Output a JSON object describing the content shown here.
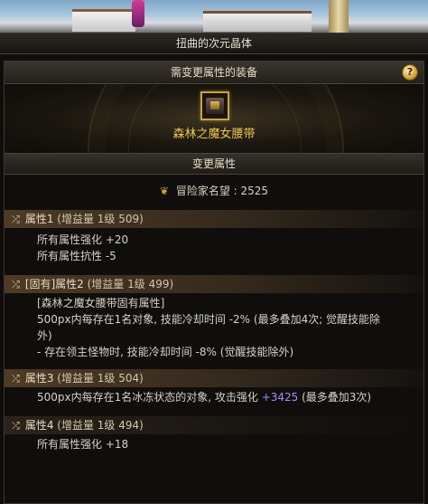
{
  "window": {
    "title": "扭曲的次元晶体"
  },
  "equip_section": {
    "header": "需变更属性的装备",
    "help_label": "?",
    "item_icon": "belt-icon",
    "item_name": "森林之魔女腰带"
  },
  "change_section": {
    "header": "变更属性",
    "fame_icon": "laurel-icon",
    "fame_label": "冒险家名望 : 2525"
  },
  "attributes": [
    {
      "icon": "shuffle-icon",
      "title": "属性1",
      "meta": " (增益量 1级 509)",
      "lines": [
        "所有属性强化 +20",
        "所有属性抗性 -5"
      ]
    },
    {
      "icon": "shuffle-icon",
      "title": "[固有]属性2",
      "meta": " (增益量 1级 499)",
      "lines": [
        "[森林之魔女腰带固有属性]",
        "500px内每存在1名对象, 技能冷却时间 -2% (最多叠加4次; 觉醒技能除外)",
        "- 存在领主怪物时, 技能冷却时间 -8% (觉醒技能除外)"
      ]
    },
    {
      "icon": "shuffle-icon",
      "title": "属性3",
      "meta": " (增益量 1级 504)",
      "line_prefix": "500px内每存在1名冰冻状态的对象, 攻击强化 ",
      "line_highlight": "+3425",
      "line_suffix": " (最多叠加3次)"
    },
    {
      "icon": "shuffle-icon",
      "title": "属性4",
      "meta": " (增益量 1级 494)",
      "lines": [
        "所有属性强化 +18"
      ]
    }
  ],
  "colors": {
    "item_name": "#f0c452",
    "highlight_value": "#a88cff",
    "frame_gold": "#c7a24a"
  }
}
